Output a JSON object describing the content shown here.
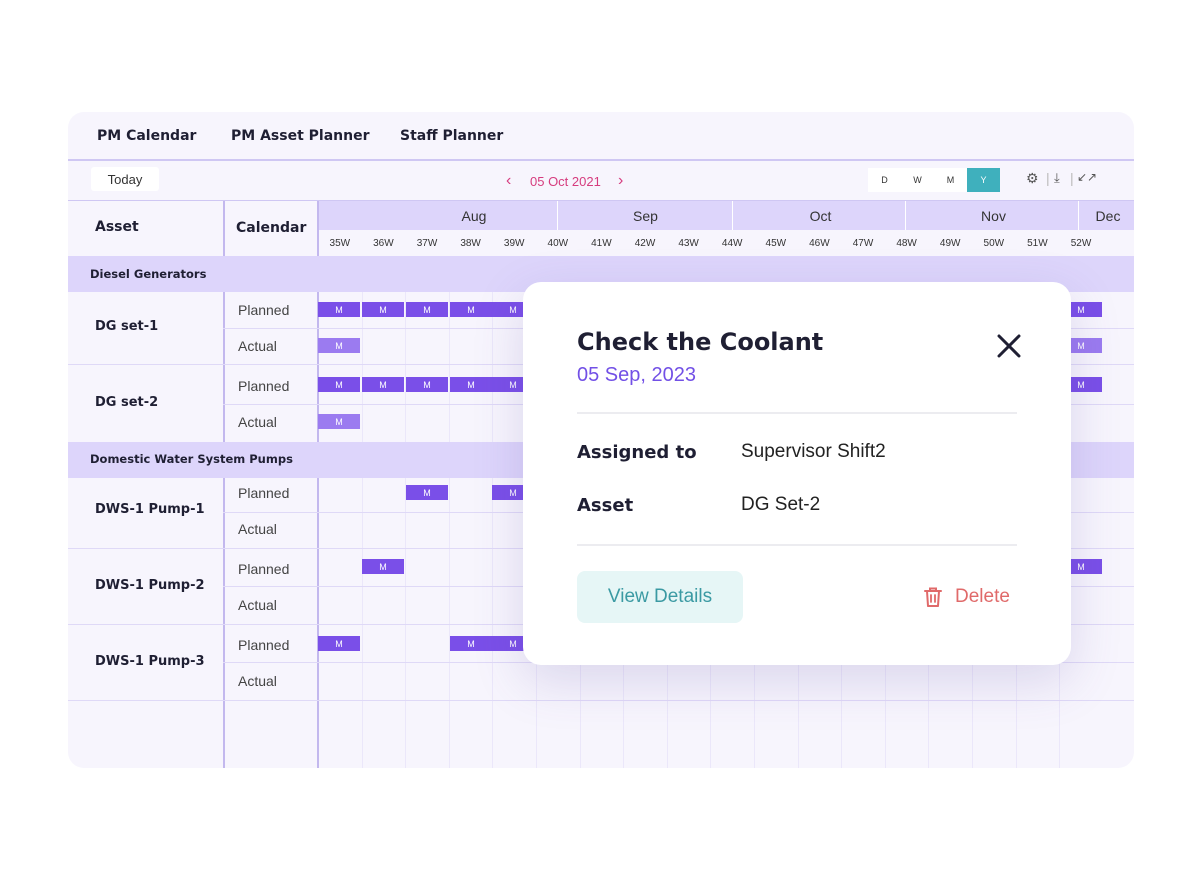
{
  "tabs": [
    {
      "label": "PM Calendar"
    },
    {
      "label": "PM Asset Planner"
    },
    {
      "label": "Staff Planner"
    }
  ],
  "toolbar": {
    "today_label": "Today",
    "date": "05 Oct 2021",
    "prev_icon": "chevron-left-icon",
    "next_icon": "chevron-right-icon",
    "views": [
      {
        "label": "D"
      },
      {
        "label": "W"
      },
      {
        "label": "M"
      },
      {
        "label": "Y",
        "active": true
      }
    ],
    "tools": [
      "gear-icon",
      "download-icon",
      "collapse-icon"
    ]
  },
  "grid": {
    "asset_header": "Asset",
    "calendar_header": "Calendar",
    "months": [
      {
        "label": "Aug"
      },
      {
        "label": "Sep"
      },
      {
        "label": "Oct"
      },
      {
        "label": "Nov"
      },
      {
        "label": "Dec"
      }
    ],
    "weeks": [
      "35W",
      "36W",
      "37W",
      "38W",
      "39W",
      "40W",
      "41W",
      "42W",
      "43W",
      "44W",
      "45W",
      "46W",
      "47W",
      "48W",
      "49W",
      "50W",
      "51W",
      "52W"
    ],
    "groups": [
      {
        "label": "Diesel Generators"
      },
      {
        "label": "Domestic Water System Pumps"
      }
    ],
    "assets": [
      {
        "name": "DG set-1",
        "planned": "Planned",
        "actual": "Actual"
      },
      {
        "name": "DG set-2",
        "planned": "Planned",
        "actual": "Actual"
      },
      {
        "name": "DWS-1 Pump-1",
        "planned": "Planned",
        "actual": "Actual"
      },
      {
        "name": "DWS-1 Pump-2",
        "planned": "Planned",
        "actual": "Actual"
      },
      {
        "name": "DWS-1 Pump-3",
        "planned": "Planned",
        "actual": "Actual"
      }
    ],
    "marker_label": "M"
  },
  "popup": {
    "title": "Check the Coolant",
    "date": "05 Sep, 2023",
    "assigned_label": "Assigned to",
    "assigned_value": "Supervisor Shift2",
    "asset_label": "Asset",
    "asset_value": "DG Set-2",
    "view_label": "View Details",
    "delete_label": "Delete",
    "close_icon": "close-icon",
    "delete_icon": "trash-icon"
  },
  "colors": {
    "accent": "#7a4fe8",
    "header_bg": "#ddd5fb",
    "date_pink": "#d63c7e",
    "view_active": "#3fb0bd",
    "delete_red": "#e06a6a"
  }
}
